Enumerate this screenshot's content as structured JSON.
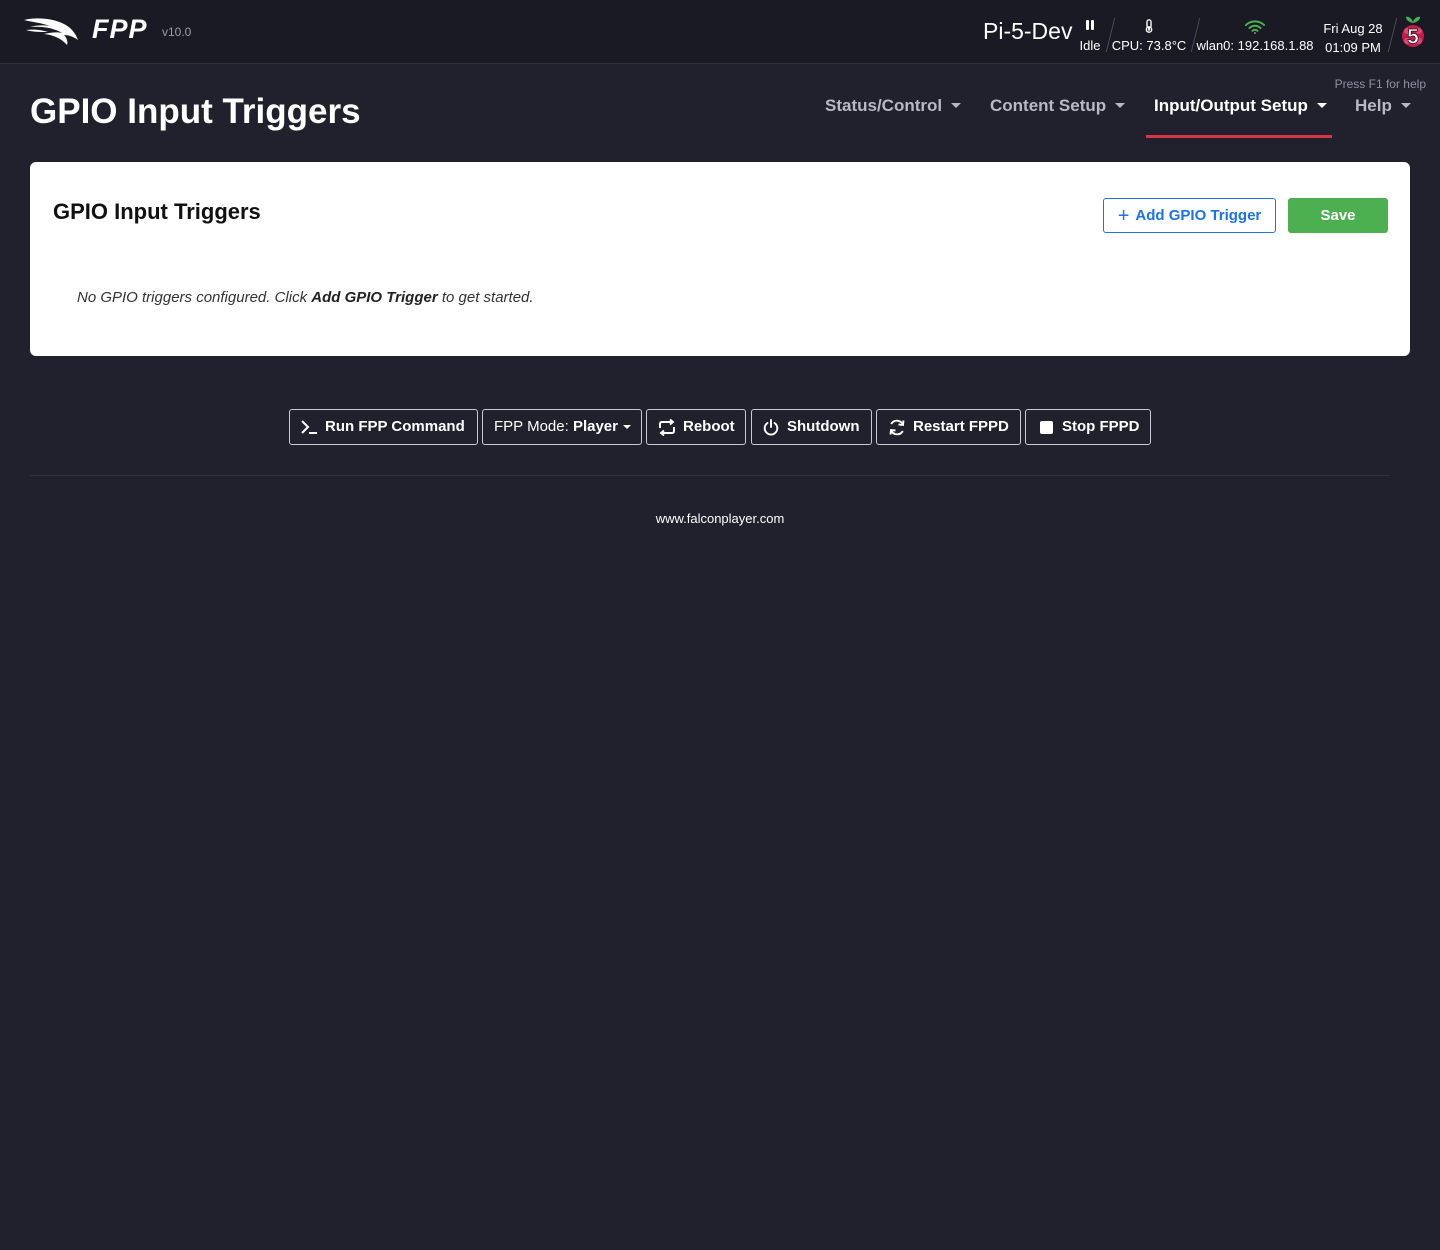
{
  "header": {
    "app_name": "FPP",
    "version": "v10.0",
    "host_name": "Pi-5-Dev",
    "status": {
      "label": "Idle",
      "icon": "pause-icon"
    },
    "cpu": {
      "label": "CPU: 73.8°C",
      "icon": "thermometer-icon"
    },
    "network": {
      "label": "wlan0: 192.168.1.88",
      "icon": "wifi-icon",
      "icon_color": "#4caf50"
    },
    "date": "Fri Aug 28",
    "time": "01:09 PM",
    "platform_badge": {
      "icon": "raspberry-pi-5-icon",
      "text": "5",
      "color": "#c51a4a"
    }
  },
  "help_hint": "Press F1 for help",
  "page_title": "GPIO Input Triggers",
  "nav": {
    "items": [
      {
        "label": "Status/Control",
        "active": false
      },
      {
        "label": "Content Setup",
        "active": false
      },
      {
        "label": "Input/Output Setup",
        "active": true
      },
      {
        "label": "Help",
        "active": false
      }
    ],
    "active_underline_color": "#dc3545"
  },
  "card": {
    "title": "GPIO Input Triggers",
    "add_button": "Add GPIO Trigger",
    "save_button": "Save",
    "empty_message": {
      "before": "No GPIO triggers configured. Click ",
      "emphasis": "Add GPIO Trigger",
      "after": " to get started."
    },
    "accent_color": "#1a73e8",
    "save_color": "#4caf50"
  },
  "actions": {
    "run_command": "Run FPP Command",
    "mode_label": "FPP Mode:",
    "mode_value": "Player",
    "reboot": "Reboot",
    "shutdown": "Shutdown",
    "restart": "Restart FPPD",
    "stop": "Stop FPPD"
  },
  "footer": {
    "link": "www.falconplayer.com"
  }
}
